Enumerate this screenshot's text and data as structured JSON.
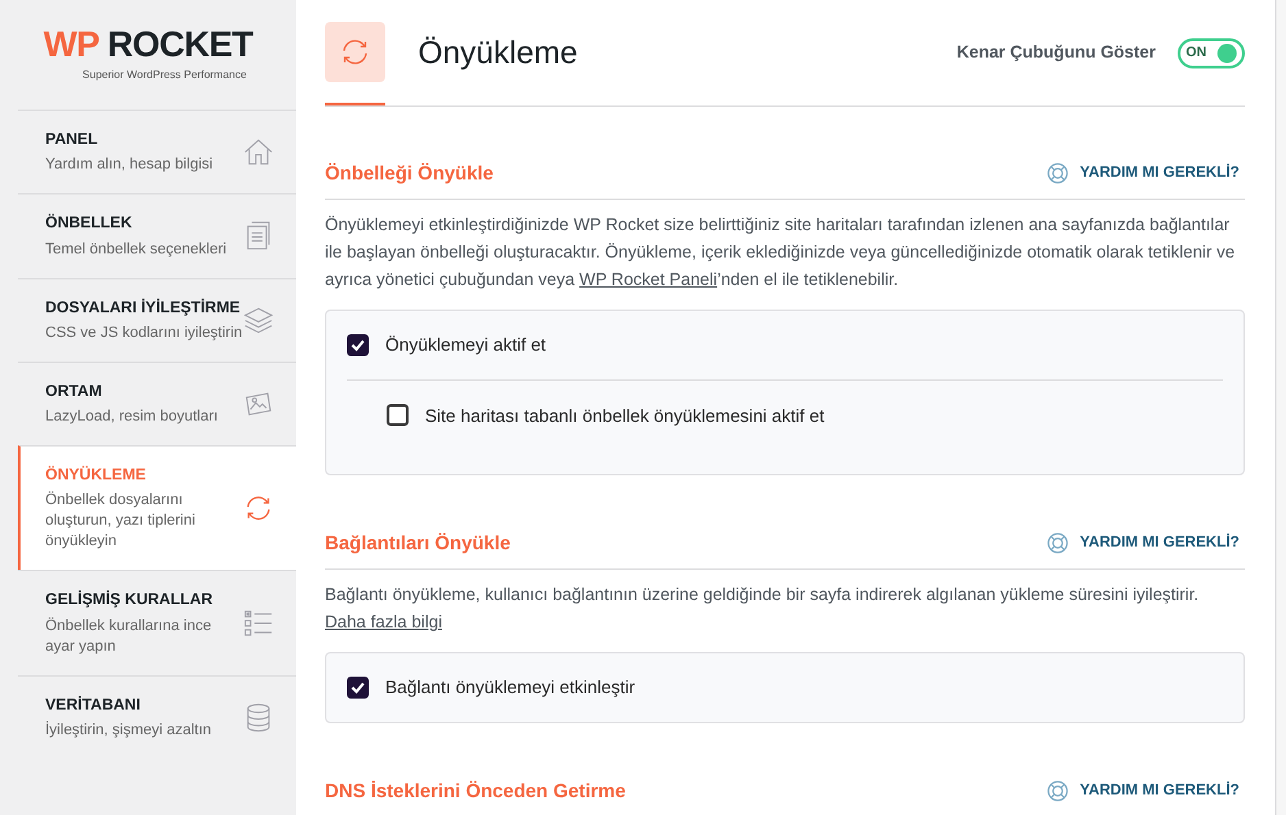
{
  "logo": {
    "wordmark_a": "WP",
    "wordmark_b": "ROCKET",
    "tagline": "Superior WordPress Performance"
  },
  "sidebar": {
    "items": [
      {
        "title": "PANEL",
        "subtitle": "Yardım alın, hesap bilgisi",
        "selected": false
      },
      {
        "title": "ÖNBELLEK",
        "subtitle": "Temel önbellek seçenekleri",
        "selected": false
      },
      {
        "title": "DOSYALARI İYİLEŞTİRME",
        "subtitle": "CSS ve JS kodlarını iyileştirin",
        "selected": false
      },
      {
        "title": "ORTAM",
        "subtitle": "LazyLoad, resim boyutları",
        "selected": false
      },
      {
        "title": "ÖNYÜKLEME",
        "subtitle": "Önbellek dosyalarını oluşturun, yazı tiplerini önyükleyin",
        "selected": true
      },
      {
        "title": "GELİŞMİŞ KURALLAR",
        "subtitle": "Önbellek kurallarına ince ayar yapın",
        "selected": false
      },
      {
        "title": "VERİTABANI",
        "subtitle": "İyileştirin, şişmeyi azaltın",
        "selected": false
      }
    ]
  },
  "header": {
    "title": "Önyükleme",
    "sidebar_toggle": {
      "label": "Kenar Çubuğunu Göster",
      "state_text": "ON",
      "on": true
    }
  },
  "sections": [
    {
      "title": "Önbelleği Önyükle",
      "help": "YARDIM MI GEREKLİ?",
      "description": {
        "before": "Önyüklemeyi etkinleştirdiğinizde WP Rocket size belirttiğiniz site haritaları tarafından izlenen ana sayfanızda bağlantılar ile başlayan önbelleği oluşturacaktır. Önyükleme, içerik eklediğinizde veya güncellediğinizde otomatik olarak tetiklenir ve ayrıca yönetici çubuğundan veya ",
        "link": "WP Rocket Paneli",
        "after": "’nden el ile tetiklenebilir."
      },
      "options": [
        {
          "label": "Önyüklemeyi aktif et",
          "checked": true,
          "children": [
            {
              "label": "Site haritası tabanlı önbellek önyüklemesini aktif et",
              "checked": false
            }
          ]
        }
      ]
    },
    {
      "title": "Bağlantıları Önyükle",
      "help": "YARDIM MI GEREKLİ?",
      "description": {
        "before": "Bağlantı önyükleme, kullanıcı bağlantının üzerine geldiğinde bir sayfa indirerek algılanan yükleme süresini iyileştirir. ",
        "link": "Daha fazla bilgi"
      },
      "options": [
        {
          "label": "Bağlantı önyüklemeyi etkinleştir",
          "checked": true
        }
      ]
    },
    {
      "title": "DNS İsteklerini Önceden Getirme",
      "help": "YARDIM MI GEREKLİ?"
    }
  ]
}
